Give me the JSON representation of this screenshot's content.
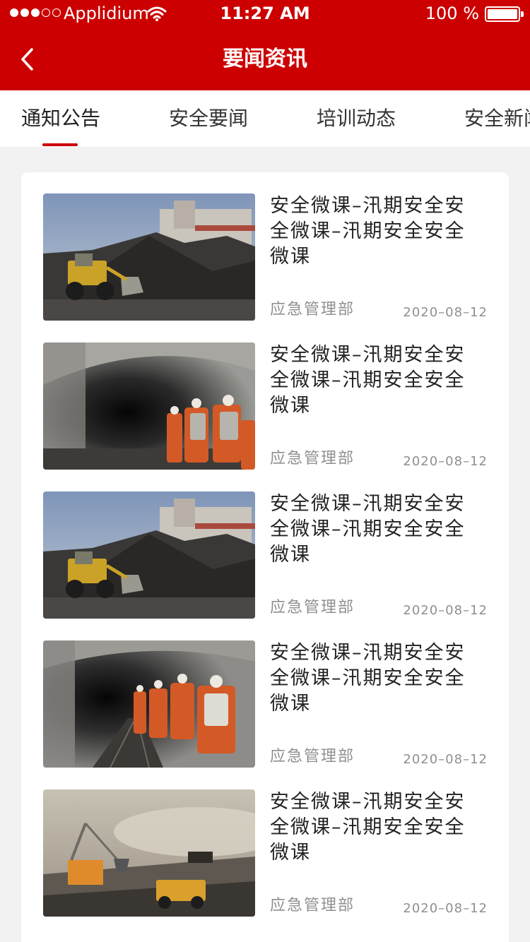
{
  "status_bar": {
    "carrier": "Applidium",
    "time": "11:27 AM",
    "battery": "100 %",
    "signal_bars_filled": 3,
    "signal_bars_total": 5
  },
  "nav": {
    "title": "要闻资讯",
    "back_icon": "chevron-left-icon"
  },
  "tabs": [
    {
      "label": "通知公告",
      "active": true
    },
    {
      "label": "安全要闻",
      "active": false
    },
    {
      "label": "培训动态",
      "active": false
    },
    {
      "label": "安全新闻",
      "active": false
    }
  ],
  "articles": [
    {
      "title": "安全微课–汛期安全安全微课–汛期安全安全微课",
      "source": "应急管理部",
      "date": "2020–08–12",
      "image": "coal-loader-photo"
    },
    {
      "title": "安全微课–汛期安全安全微课–汛期安全安全微课",
      "source": "应急管理部",
      "date": "2020–08–12",
      "image": "tunnel-miners-photo"
    },
    {
      "title": "安全微课–汛期安全安全微课–汛期安全安全微课",
      "source": "应急管理部",
      "date": "2020–08–12",
      "image": "coal-loader-photo"
    },
    {
      "title": "安全微课–汛期安全安全微课–汛期安全安全微课",
      "source": "应急管理部",
      "date": "2020–08–12",
      "image": "tunnel-miners-photo"
    },
    {
      "title": "安全微课–汛期安全安全微课–汛期安全安全微课",
      "source": "应急管理部",
      "date": "2020–08–12",
      "image": "open-pit-mine-photo"
    }
  ],
  "colors": {
    "brand_red": "#cc0000",
    "background": "#f2f2f2",
    "meta_gray": "#8f8f8f"
  }
}
